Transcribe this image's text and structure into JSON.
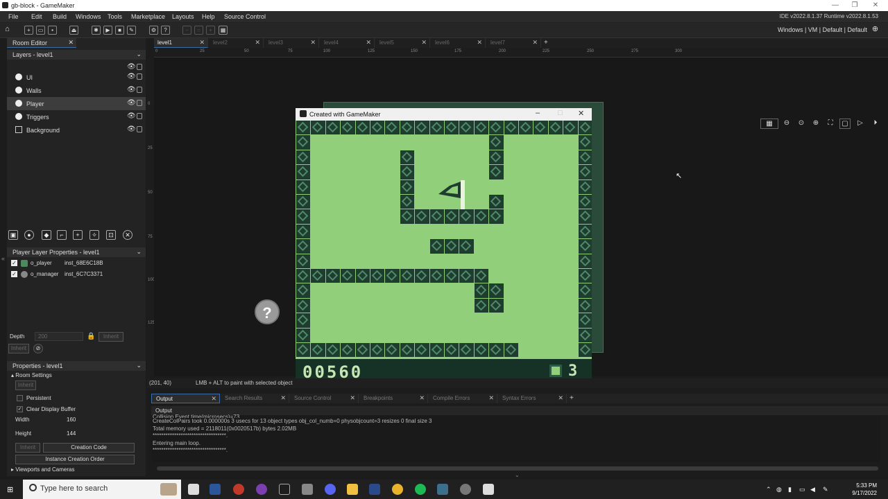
{
  "window": {
    "title": "gb-block - GameMaker"
  },
  "menu": {
    "items": [
      "File",
      "Edit",
      "Build",
      "Windows",
      "Tools",
      "Marketplace",
      "Layouts",
      "Help",
      "Source Control"
    ],
    "version": "IDE v2022.8.1.37  Runtime v2022.8.1.53"
  },
  "toolbar": {
    "config": "Windows | VM | Default | Default"
  },
  "room_editor": {
    "tab_label": "Room Editor",
    "layers_header": "Layers - level1",
    "layers": [
      "UI",
      "Walls",
      "Player",
      "Triggers",
      "Background"
    ],
    "selected_layer": "Player",
    "layer_props_header": "Player Layer Properties - level1",
    "instances": [
      {
        "name": "o_player",
        "id": "inst_68E6C18B"
      },
      {
        "name": "o_manager",
        "id": "inst_6C7C3371"
      }
    ],
    "depth_label": "Depth",
    "depth_value": "200",
    "inherit": "Inherit",
    "props_header": "Properties - level1",
    "room_settings": "Room Settings",
    "persistent": "Persistent",
    "clear_display_buffer": "Clear Display Buffer",
    "width_label": "Width",
    "width_value": "160",
    "height_label": "Height",
    "height_value": "144",
    "creation_code": "Creation Code",
    "instance_creation_order": "Instance Creation Order",
    "viewports": "Viewports and Cameras"
  },
  "room_tabs": [
    "level1",
    "level2",
    "level3",
    "level4",
    "level5",
    "level6",
    "level7"
  ],
  "ruler": [
    "0",
    "25",
    "50",
    "75",
    "100",
    "125",
    "150",
    "175",
    "200",
    "225",
    "250",
    "275",
    "300"
  ],
  "vruler": [
    "0",
    "25",
    "50",
    "75",
    "100",
    "125",
    "150",
    "175"
  ],
  "game_window": {
    "title": "Created with GameMaker",
    "score": "00560",
    "lives": "3"
  },
  "status": {
    "coords": "(201, 40)",
    "hint": "LMB + ALT to paint with selected object"
  },
  "output_tabs": [
    "Output",
    "Search Results",
    "Source Control",
    "Breakpoints",
    "Compile Errors",
    "Syntax Errors"
  ],
  "output": {
    "header": "Output",
    "lines": [
      "Collision Event time(microsecs)=73",
      "CreateColPairs took 0.000000s 3 usecs for 13 object types obj_col_numb=0 physobjcount=3 resizes 0 final size 3",
      "Total memory used = 2118011(0x0020517b) bytes 2.02MB",
      "**********************************.",
      "Entering main loop.",
      "**********************************."
    ]
  },
  "taskbar": {
    "search_placeholder": "Type here to search",
    "time": "5:33 PM",
    "date": "9/17/2022"
  }
}
